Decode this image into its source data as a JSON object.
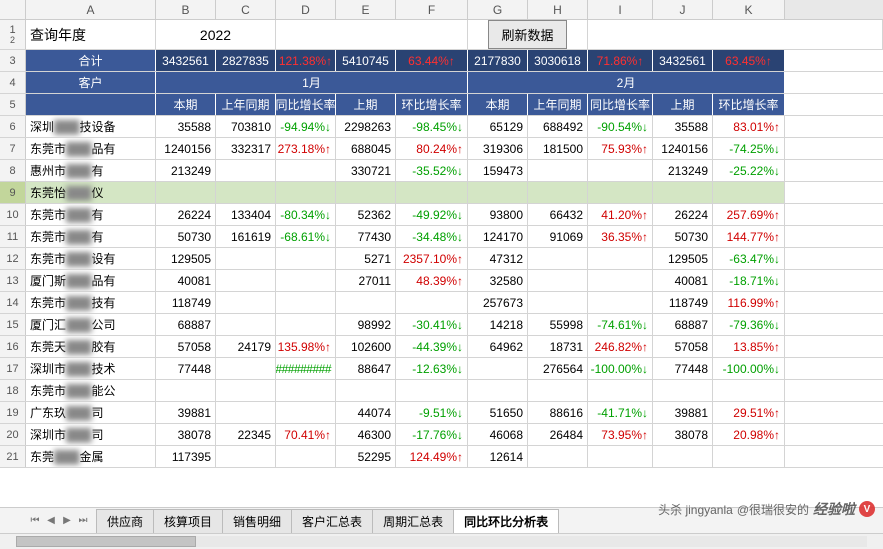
{
  "cols": [
    "A",
    "B",
    "C",
    "D",
    "E",
    "F",
    "G",
    "H",
    "I",
    "J",
    "K"
  ],
  "query_year_label": "查询年度",
  "query_year_value": "2022",
  "refresh_btn": "刷新数据",
  "totals_label": "合计",
  "totals": [
    "3432561",
    "2827835",
    "121.38%↑",
    "5410745",
    "63.44%↑",
    "2177830",
    "3030618",
    "71.86%↑",
    "3432561",
    "63.45%↑"
  ],
  "totals_red": [
    false,
    false,
    true,
    false,
    true,
    false,
    false,
    true,
    false,
    true
  ],
  "customer_label": "客户",
  "month1": "1月",
  "month2": "2月",
  "subcols": [
    "本期",
    "上年同期",
    "同比增长率",
    "上期",
    "环比增长率",
    "本期",
    "上年同期",
    "同比增长率",
    "上期",
    "环比增长率"
  ],
  "rows": [
    {
      "rn": 6,
      "name": "深圳",
      "mid": "技设备",
      "d": [
        "35588",
        "703810",
        "-94.94%↓",
        "2298263",
        "-98.45%↓",
        "65129",
        "688492",
        "-90.54%↓",
        "35588",
        "83.01%↑"
      ],
      "c": [
        "",
        "",
        "g",
        "",
        "g",
        "",
        "",
        "g",
        "",
        "r"
      ]
    },
    {
      "rn": 7,
      "name": "东莞市",
      "mid": "品有",
      "d": [
        "1240156",
        "332317",
        "273.18%↑",
        "688045",
        "80.24%↑",
        "319306",
        "181500",
        "75.93%↑",
        "1240156",
        "-74.25%↓"
      ],
      "c": [
        "",
        "",
        "r",
        "",
        "r",
        "",
        "",
        "r",
        "",
        "g"
      ]
    },
    {
      "rn": 8,
      "name": "惠州市",
      "mid": "有",
      "d": [
        "213249",
        "",
        "",
        "330721",
        "-35.52%↓",
        "159473",
        "",
        "",
        "213249",
        "-25.22%↓"
      ],
      "c": [
        "",
        "",
        "",
        "",
        "g",
        "",
        "",
        "",
        "",
        "g"
      ]
    },
    {
      "rn": 9,
      "name": "东莞怡",
      "mid": "仪",
      "d": [
        "",
        "",
        "",
        "",
        "",
        "",
        "",
        "",
        "",
        ""
      ],
      "c": [
        "",
        "",
        "",
        "",
        "",
        "",
        "",
        "",
        "",
        ""
      ],
      "sel": true
    },
    {
      "rn": 10,
      "name": "东莞市",
      "mid": "有",
      "d": [
        "26224",
        "133404",
        "-80.34%↓",
        "52362",
        "-49.92%↓",
        "93800",
        "66432",
        "41.20%↑",
        "26224",
        "257.69%↑"
      ],
      "c": [
        "",
        "",
        "g",
        "",
        "g",
        "",
        "",
        "r",
        "",
        "r"
      ]
    },
    {
      "rn": 11,
      "name": "东莞市",
      "mid": "有",
      "d": [
        "50730",
        "161619",
        "-68.61%↓",
        "77430",
        "-34.48%↓",
        "124170",
        "91069",
        "36.35%↑",
        "50730",
        "144.77%↑"
      ],
      "c": [
        "",
        "",
        "g",
        "",
        "g",
        "",
        "",
        "r",
        "",
        "r"
      ]
    },
    {
      "rn": 12,
      "name": "东莞市",
      "mid": "设有",
      "d": [
        "129505",
        "",
        "",
        "5271",
        "2357.10%↑",
        "47312",
        "",
        "",
        "129505",
        "-63.47%↓"
      ],
      "c": [
        "",
        "",
        "",
        "",
        "r",
        "",
        "",
        "",
        "",
        "g"
      ]
    },
    {
      "rn": 13,
      "name": "厦门斯",
      "mid": "品有",
      "d": [
        "40081",
        "",
        "",
        "27011",
        "48.39%↑",
        "32580",
        "",
        "",
        "40081",
        "-18.71%↓"
      ],
      "c": [
        "",
        "",
        "",
        "",
        "r",
        "",
        "",
        "",
        "",
        "g"
      ]
    },
    {
      "rn": 14,
      "name": "东莞市",
      "mid": "技有",
      "d": [
        "118749",
        "",
        "",
        "",
        "",
        "257673",
        "",
        "",
        "118749",
        "116.99%↑"
      ],
      "c": [
        "",
        "",
        "",
        "",
        "",
        "",
        "",
        "",
        "",
        "r"
      ]
    },
    {
      "rn": 15,
      "name": "厦门汇",
      "mid": "公司",
      "d": [
        "68887",
        "",
        "",
        "98992",
        "-30.41%↓",
        "14218",
        "55998",
        "-74.61%↓",
        "68887",
        "-79.36%↓"
      ],
      "c": [
        "",
        "",
        "",
        "",
        "g",
        "",
        "",
        "g",
        "",
        "g"
      ]
    },
    {
      "rn": 16,
      "name": "东莞天",
      "mid": "胶有",
      "d": [
        "57058",
        "24179",
        "135.98%↑",
        "102600",
        "-44.39%↓",
        "64962",
        "18731",
        "246.82%↑",
        "57058",
        "13.85%↑"
      ],
      "c": [
        "",
        "",
        "r",
        "",
        "g",
        "",
        "",
        "r",
        "",
        "r"
      ]
    },
    {
      "rn": 17,
      "name": "深圳市",
      "mid": "技术",
      "d": [
        "77448",
        "",
        "#############",
        "88647",
        "-12.63%↓",
        "",
        "276564",
        "-100.00%↓",
        "77448",
        "-100.00%↓"
      ],
      "c": [
        "",
        "",
        "h",
        "",
        "g",
        "",
        "",
        "g",
        "",
        "g"
      ]
    },
    {
      "rn": 18,
      "name": "东莞市",
      "mid": "能公",
      "d": [
        "",
        "",
        "",
        "",
        "",
        "",
        "",
        "",
        "",
        ""
      ],
      "c": [
        "",
        "",
        "",
        "",
        "",
        "",
        "",
        "",
        "",
        ""
      ]
    },
    {
      "rn": 19,
      "name": "广东玖",
      "mid": "司",
      "d": [
        "39881",
        "",
        "",
        "44074",
        "-9.51%↓",
        "51650",
        "88616",
        "-41.71%↓",
        "39881",
        "29.51%↑"
      ],
      "c": [
        "",
        "",
        "",
        "",
        "g",
        "",
        "",
        "g",
        "",
        "r"
      ]
    },
    {
      "rn": 20,
      "name": "深圳市",
      "mid": "司",
      "d": [
        "38078",
        "22345",
        "70.41%↑",
        "46300",
        "-17.76%↓",
        "46068",
        "26484",
        "73.95%↑",
        "38078",
        "20.98%↑"
      ],
      "c": [
        "",
        "",
        "r",
        "",
        "g",
        "",
        "",
        "r",
        "",
        "r"
      ]
    },
    {
      "rn": 21,
      "name": "东莞",
      "mid": "金属",
      "d": [
        "117395",
        "",
        "",
        "52295",
        "124.49%↑",
        "12614",
        "",
        "",
        "",
        ""
      ],
      "c": [
        "",
        "",
        "",
        "",
        "r",
        "",
        "",
        "",
        "",
        ""
      ]
    }
  ],
  "tabs": [
    "供应商",
    "核算项目",
    "销售明细",
    "客户汇总表",
    "周期汇总表",
    "同比环比分析表"
  ],
  "active_tab": 5,
  "watermark_handle": "@很瑞很安的",
  "watermark_brand": "经验啦",
  "watermark_sub": "头杀 jingyanla"
}
